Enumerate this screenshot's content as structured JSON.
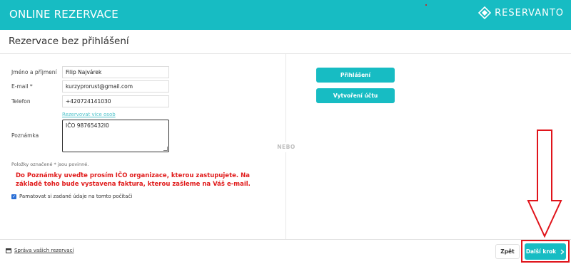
{
  "header": {
    "title": "ONLINE REZERVACE",
    "brand": "RESERVANTO",
    "color": "#17bcc3"
  },
  "page": {
    "subtitle": "Rezervace bez přihlášení"
  },
  "form": {
    "name_label": "Jméno a příjmení",
    "name_value": "Filip Najvárek",
    "email_label": "E-mail *",
    "email_value": "kurzyprorust@gmail.com",
    "phone_label": "Telefon",
    "phone_value": "+420724141030",
    "more_people_link": "Rezervovat více osob",
    "note_label": "Poznámka",
    "note_value": "IČO 98765432l0",
    "required_note": "Položky označené * jsou povinné.",
    "warning": "Do Poznámky uveďte prosím IČO organizace, kterou zastupujete. Na základě toho bude vystavena faktura, kterou zašleme na Váš e-mail.",
    "remember_label": "Pamatovat si zadané údaje na tomto počítači",
    "remember_checked": true
  },
  "divider": {
    "label": "NEBO"
  },
  "account": {
    "login_label": "Přihlášení",
    "create_label": "Vytvoření účtu"
  },
  "footer": {
    "manage_label": "Správa vašich rezervací",
    "back_label": "Zpět",
    "next_label": "Další krok",
    "highlight_color": "#e0141b"
  }
}
